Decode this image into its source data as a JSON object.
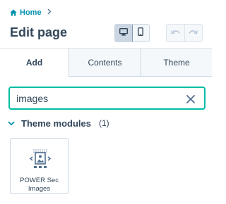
{
  "breadcrumb": {
    "home_label": "Home"
  },
  "header": {
    "title": "Edit page",
    "device_toggle": {
      "selected": "desktop",
      "options": [
        "desktop-icon",
        "mobile-icon"
      ]
    },
    "history": {
      "icons": [
        "undo-icon",
        "redo-icon"
      ]
    }
  },
  "tabs": [
    {
      "label": "Add",
      "active": true
    },
    {
      "label": "Contents",
      "active": false
    },
    {
      "label": "Theme",
      "active": false
    }
  ],
  "search": {
    "value": "images",
    "placeholder": ""
  },
  "section": {
    "title": "Theme modules",
    "count": "(1)",
    "expanded": true
  },
  "modules": [
    {
      "label_line1": "POWER Sec",
      "label_line2": "Images",
      "icon": "image-module-icon"
    }
  ],
  "colors": {
    "accent": "#00bda5",
    "link": "#0091ae",
    "text": "#33475b",
    "tab_background": "#f5f8fa",
    "border": "#cbd6e2"
  }
}
